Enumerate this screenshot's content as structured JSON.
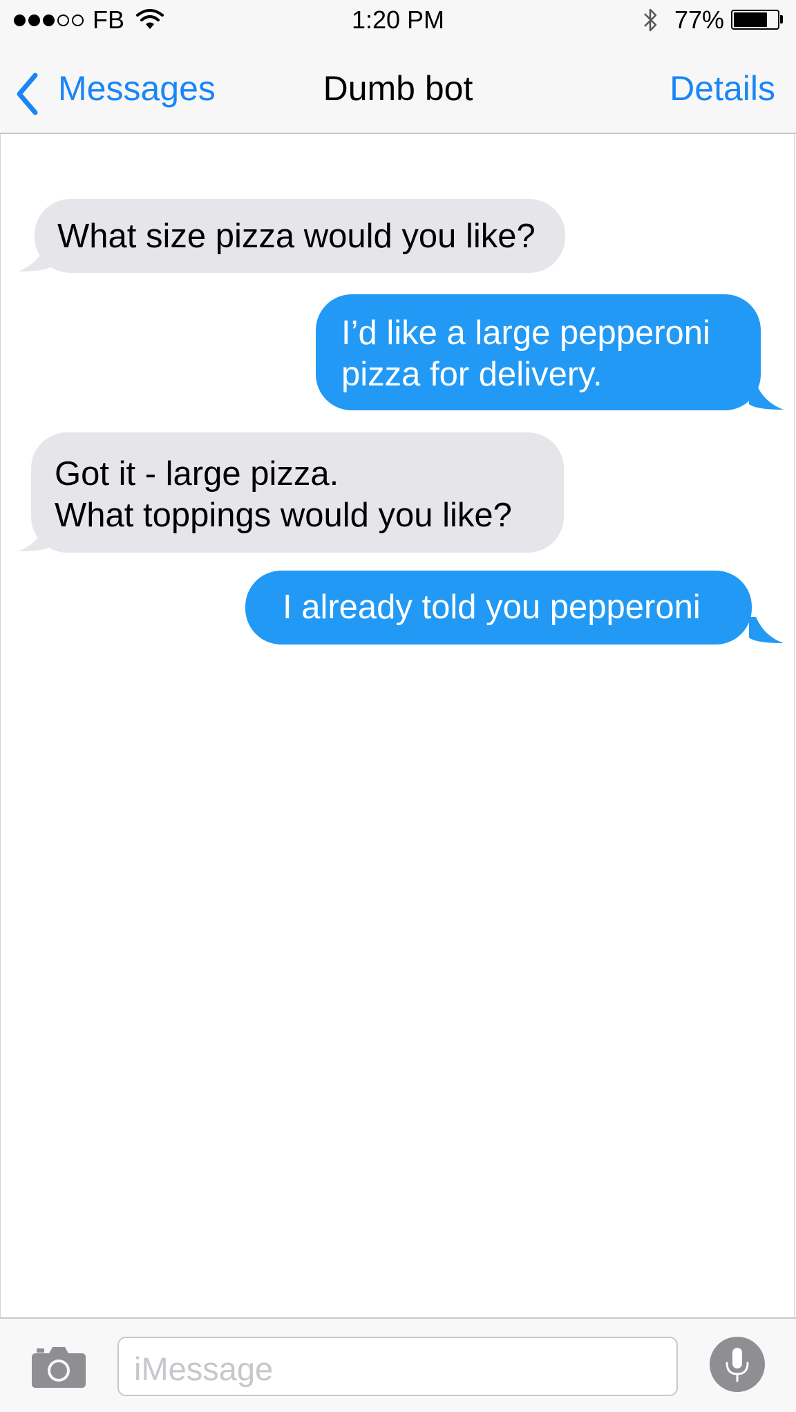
{
  "status_bar": {
    "carrier": "FB",
    "time": "1:20 PM",
    "battery_percent": "77%",
    "battery_level": 0.77,
    "signal_bars_filled": 3,
    "signal_bars_total": 5,
    "icons": [
      "wifi-icon",
      "bluetooth-icon",
      "battery-icon"
    ]
  },
  "nav": {
    "back_label": "Messages",
    "title": "Dumb bot",
    "details_label": "Details"
  },
  "messages": [
    {
      "direction": "incoming",
      "text": "What size pizza would you like?"
    },
    {
      "direction": "outgoing",
      "text": "I’d like a large pepperoni\npizza for delivery."
    },
    {
      "direction": "incoming",
      "text": "Got it - large pizza.\nWhat toppings would you like?"
    },
    {
      "direction": "outgoing",
      "text": "I already told you pepperoni"
    }
  ],
  "input_bar": {
    "placeholder": "iMessage",
    "icons": [
      "camera-icon",
      "microphone-icon"
    ]
  },
  "colors": {
    "accent": "#1a86f6",
    "outgoing_bubble": "#229af5",
    "incoming_bubble": "#e5e5ea",
    "bar_background": "#f7f7f7"
  }
}
